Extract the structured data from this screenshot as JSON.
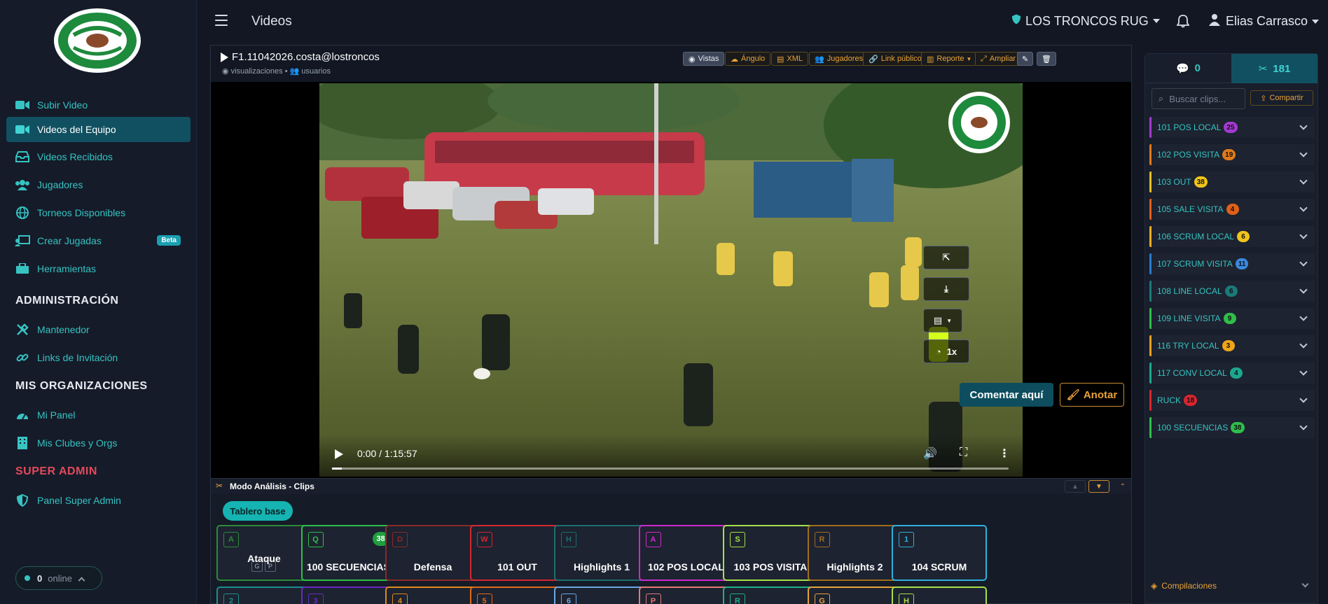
{
  "sidebar": {
    "items": [
      {
        "label": "Subir Video",
        "icon": "video-camera-icon"
      },
      {
        "label": "Videos del Equipo",
        "icon": "video-camera-icon",
        "active": true
      },
      {
        "label": "Videos Recibidos",
        "icon": "inbox-icon"
      },
      {
        "label": "Jugadores",
        "icon": "users-icon"
      },
      {
        "label": "Torneos Disponibles",
        "icon": "globe-icon"
      },
      {
        "label": "Crear Jugadas",
        "icon": "chalkboard-icon",
        "badge": "Beta"
      },
      {
        "label": "Herramientas",
        "icon": "toolbox-icon"
      }
    ],
    "admin_heading": "ADMINISTRACIÓN",
    "admin_items": [
      {
        "label": "Mantenedor",
        "icon": "tools-icon"
      },
      {
        "label": "Links de Invitación",
        "icon": "link-icon"
      }
    ],
    "orgs_heading": "MIS ORGANIZACIONES",
    "orgs_items": [
      {
        "label": "Mi Panel",
        "icon": "dashboard-icon"
      },
      {
        "label": "Mis Clubes y Orgs",
        "icon": "building-icon"
      }
    ],
    "super_heading": "SUPER ADMIN",
    "super_items": [
      {
        "label": "Panel Super Admin",
        "icon": "shield-icon"
      }
    ],
    "online": {
      "count": "0",
      "label": "online"
    }
  },
  "topbar": {
    "title": "Videos",
    "club": "LOS TRONCOS RUG",
    "user": "Elias Carrasco"
  },
  "video": {
    "title": "F1.11042026.costa@lostroncos",
    "sub_views": "visualizaciones",
    "sub_sep": "•",
    "sub_users": "usuarios",
    "toolbar": {
      "vistas": "Vistas",
      "angulo": "Ángulo",
      "xml": "XML",
      "jugadores": "Jugadores",
      "link": "Link público",
      "reporte": "Reporte",
      "ampliar": "Ampliar"
    },
    "time": "0:00 / 1:15:57",
    "speed": "1x",
    "comment": "Comentar aquí",
    "annotate": "Anotar"
  },
  "analysis": {
    "title": "Modo Análisis - Clips",
    "board": "Tablero base",
    "clips": [
      {
        "key": "A",
        "label": "Ataque",
        "color": "#2e8b3a",
        "subkeys": [
          "G",
          "P"
        ]
      },
      {
        "key": "Q",
        "label": "100 SECUENCIAS",
        "color": "#2fbf4a",
        "count": "38"
      },
      {
        "key": "D",
        "label": "Defensa",
        "color": "#8a2a2a"
      },
      {
        "key": "W",
        "label": "101 OUT",
        "color": "#d7262f"
      },
      {
        "key": "H",
        "label": "Highlights 1",
        "color": "#1b6f6f"
      },
      {
        "key": "A",
        "label": "102 POS LOCAL",
        "color": "#d028d0"
      },
      {
        "key": "S",
        "label": "103 POS VISITA",
        "color": "#a6e04a"
      },
      {
        "key": "R",
        "label": "Highlights 2",
        "color": "#a46d1d"
      },
      {
        "key": "1",
        "label": "104 SCRUM",
        "color": "#2fb0e0"
      }
    ],
    "row2_keys": [
      {
        "key": "2",
        "color": "#1b8f8f"
      },
      {
        "key": "3",
        "color": "#6a2ac0"
      },
      {
        "key": "4",
        "color": "#e08a1a"
      },
      {
        "key": "5",
        "color": "#e06a1a"
      },
      {
        "key": "6",
        "color": "#6aa8e8"
      },
      {
        "key": "P",
        "color": "#e87878"
      },
      {
        "key": "R",
        "color": "#20b08a"
      },
      {
        "key": "G",
        "color": "#e8a23a"
      },
      {
        "key": "H",
        "color": "#a6e04a"
      }
    ]
  },
  "rpanel": {
    "tab_comments": "0",
    "tab_clips": "181",
    "search_placeholder": "Buscar clips...",
    "share": "Compartir",
    "items": [
      {
        "label": "101 POS LOCAL",
        "count": "25",
        "color": "#a23ad0",
        "count_color": "#a23ad0"
      },
      {
        "label": "102 POS VISITA",
        "count": "19",
        "color": "#e07a1a",
        "count_color": "#e07a1a"
      },
      {
        "label": "103 OUT",
        "count": "38",
        "color": "#e8c020",
        "count_color": "#f0c419"
      },
      {
        "label": "105 SALE VISITA",
        "count": "4",
        "color": "#e0601a",
        "count_color": "#e0601a"
      },
      {
        "label": "106 SCRUM LOCAL",
        "count": "6",
        "color": "#e8b020",
        "count_color": "#f0c419"
      },
      {
        "label": "107 SCRUM VISITA",
        "count": "11",
        "color": "#2a7ad0",
        "count_color": "#3a8ae0"
      },
      {
        "label": "108 LINE LOCAL",
        "count": "6",
        "color": "#1b7a7a",
        "count_color": "#1b7a7a"
      },
      {
        "label": "109 LINE VISITA",
        "count": "9",
        "color": "#2fbf4a",
        "count_color": "#2fbf4a"
      },
      {
        "label": "116 TRY LOCAL",
        "count": "3",
        "color": "#e8a020",
        "count_color": "#f0a419"
      },
      {
        "label": "117 CONV LOCAL",
        "count": "4",
        "color": "#1ba88f",
        "count_color": "#1ba88f"
      },
      {
        "label": "RUCK",
        "count": "18",
        "color": "#d7262f",
        "count_color": "#d7262f"
      },
      {
        "label": "100 SECUENCIAS",
        "count": "38",
        "color": "#2fbf4a",
        "count_color": "#2fbf4a"
      }
    ],
    "compilations": "Compilaciones"
  }
}
